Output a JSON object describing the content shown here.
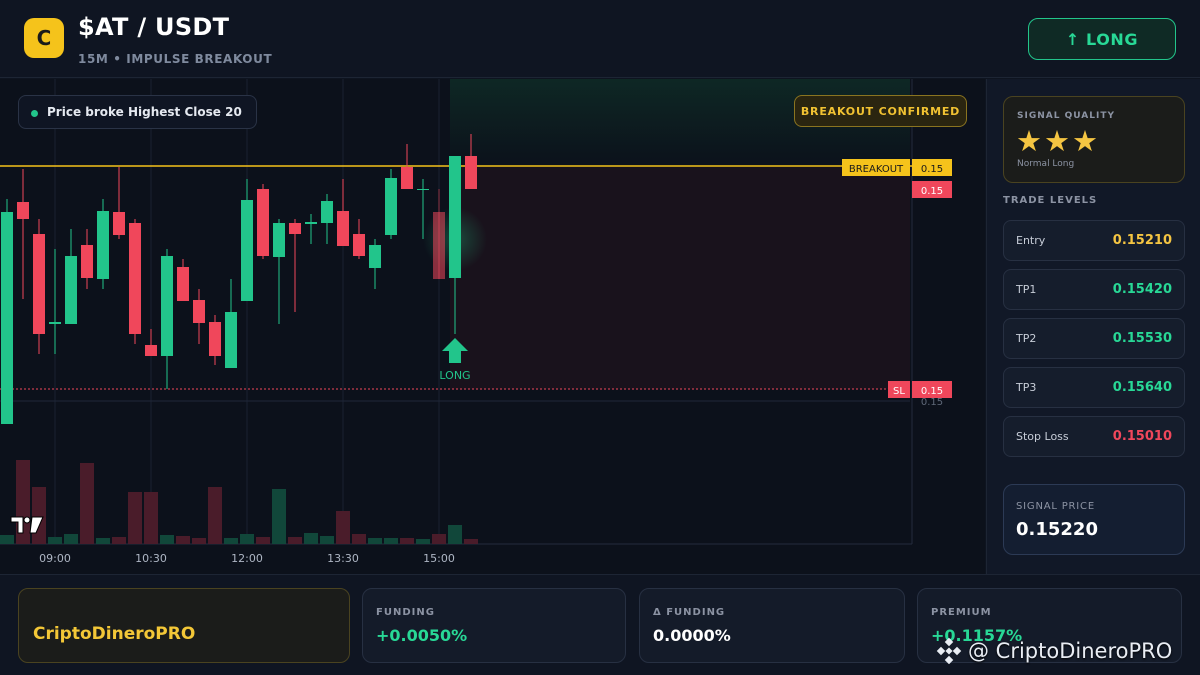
{
  "header": {
    "coin_letter": "C",
    "pair": "$AT / USDT",
    "subtitle": "15M • IMPULSE BREAKOUT",
    "long_label": "↑ LONG"
  },
  "chart": {
    "tag": "Price broke Highest Close 20",
    "confirm": "BREAKOUT CONFIRMED",
    "breakout_label": "BREAKOUT",
    "breakout_value": "0.15",
    "price_value": "0.15",
    "sl_label": "SL",
    "sl_value": "0.15",
    "axis_value": "0.15",
    "long_marker": "LONG",
    "time_labels": [
      "09:00",
      "10:30",
      "12:00",
      "13:30",
      "15:00"
    ]
  },
  "panel": {
    "quality_label": "SIGNAL QUALITY",
    "stars": "★★★",
    "quality_sub": "Normal Long",
    "levels_title": "TRADE LEVELS",
    "levels": [
      {
        "name": "Entry",
        "value": "0.15210",
        "color": "#f5c542"
      },
      {
        "name": "TP1",
        "value": "0.15420",
        "color": "#28d896"
      },
      {
        "name": "TP2",
        "value": "0.15530",
        "color": "#28d896"
      },
      {
        "name": "TP3",
        "value": "0.15640",
        "color": "#28d896"
      },
      {
        "name": "Stop Loss",
        "value": "0.15010",
        "color": "#f0475b"
      }
    ],
    "signal_label": "SIGNAL PRICE",
    "signal_value": "0.15220"
  },
  "bottom": {
    "brand": "CriptoDineroPRO",
    "funding_label": "FUNDING",
    "funding_value": "+0.0050%",
    "dfunding_label": "Δ FUNDING",
    "dfunding_value": "0.0000%",
    "premium_label": "PREMIUM",
    "premium_value": "+0.1157%",
    "watermark": "@ CriptoDineroPRO"
  },
  "colors": {
    "green": "#22c58b",
    "red": "#f0475b",
    "yellow": "#f5c31b"
  }
}
